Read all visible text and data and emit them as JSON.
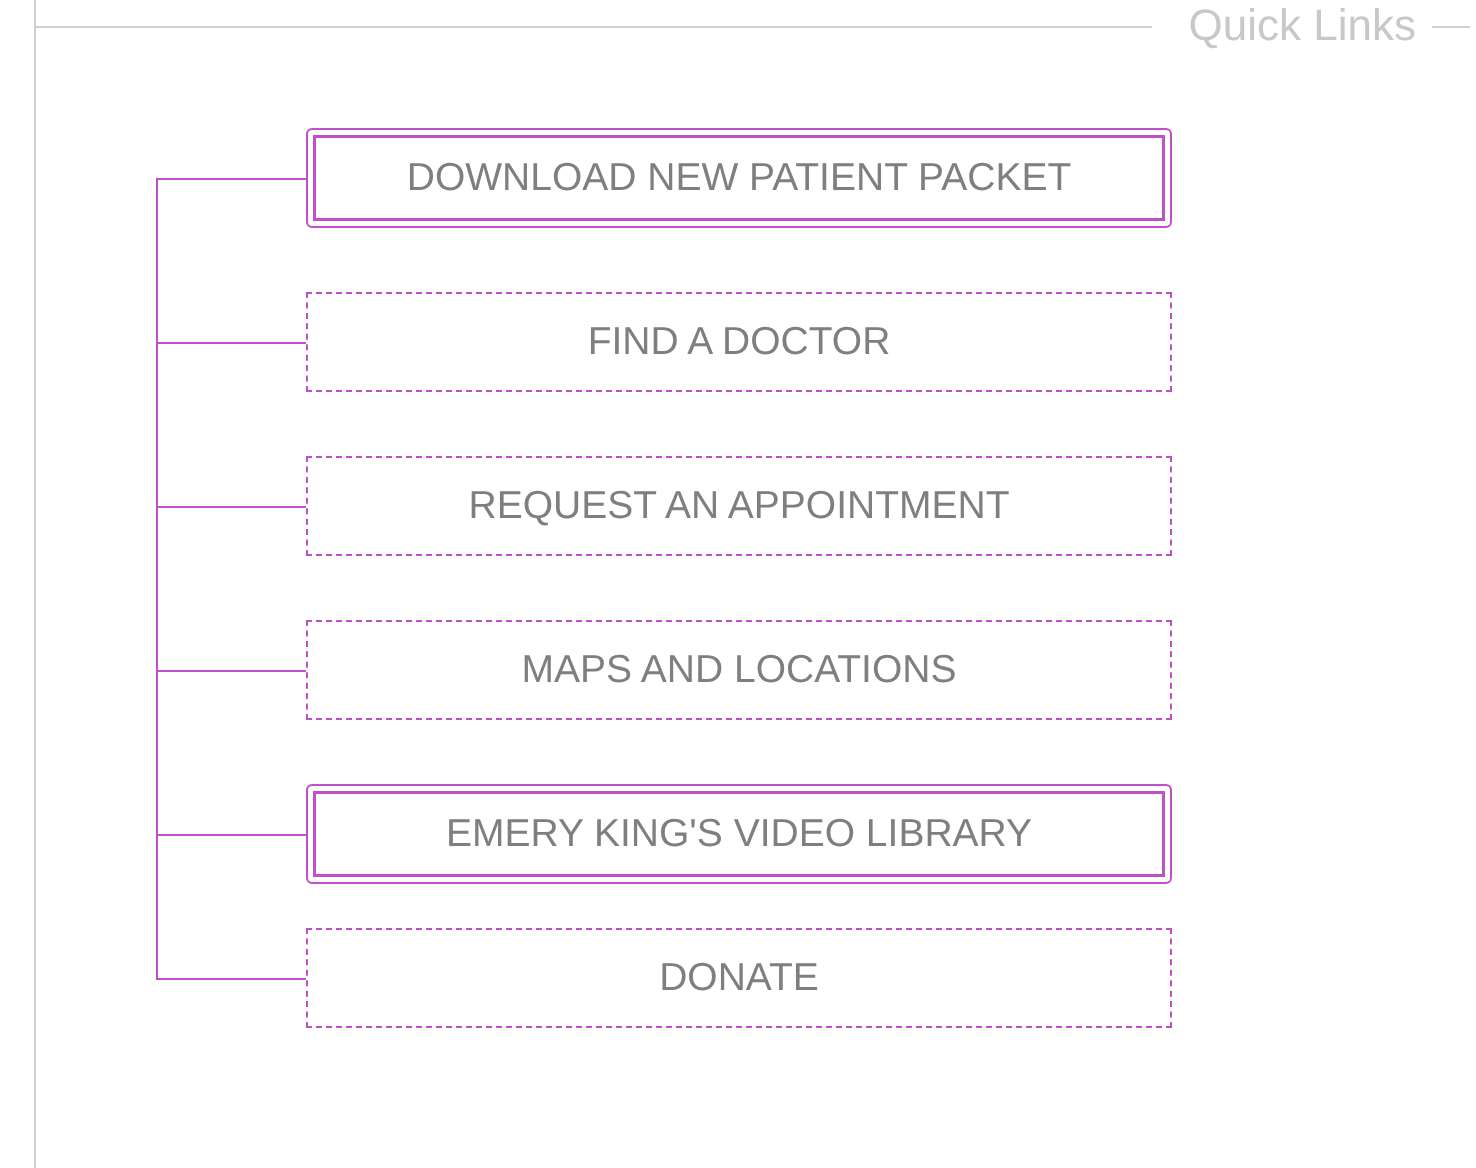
{
  "panel": {
    "title": "Quick Links"
  },
  "links": [
    {
      "label": "DOWNLOAD NEW PATIENT PACKET",
      "kind": "double"
    },
    {
      "label": "FIND A DOCTOR",
      "kind": "dashed"
    },
    {
      "label": "REQUEST AN APPOINTMENT",
      "kind": "dashed"
    },
    {
      "label": "MAPS AND LOCATIONS",
      "kind": "dashed"
    },
    {
      "label": "EMERY KING'S VIDEO LIBRARY",
      "kind": "double"
    },
    {
      "label": "DONATE",
      "kind": "dashed"
    }
  ]
}
